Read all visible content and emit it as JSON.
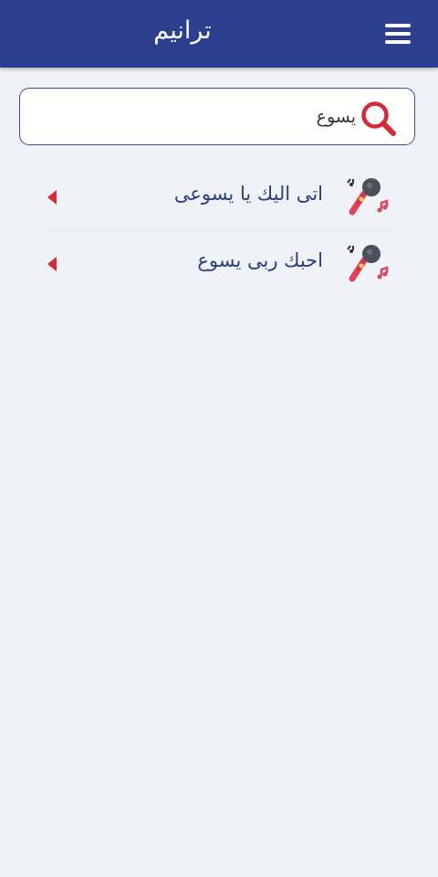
{
  "app_bar": {
    "title": "ترانيم",
    "menu_icon": "hamburger-menu-icon",
    "background_color": "#2b3f8e"
  },
  "search": {
    "value": "يسوع",
    "placeholder": "",
    "icon": "search-icon",
    "icon_color": "#d42a3c"
  },
  "songs": [
    {
      "title": "اتى اليك يا يسوعى",
      "icon": "microphone-icon"
    },
    {
      "title": "احبك ربى يسوع",
      "icon": "microphone-icon"
    }
  ],
  "colors": {
    "accent": "#d42a3c",
    "text": "#2c3e7e",
    "background": "#eff2f7"
  }
}
